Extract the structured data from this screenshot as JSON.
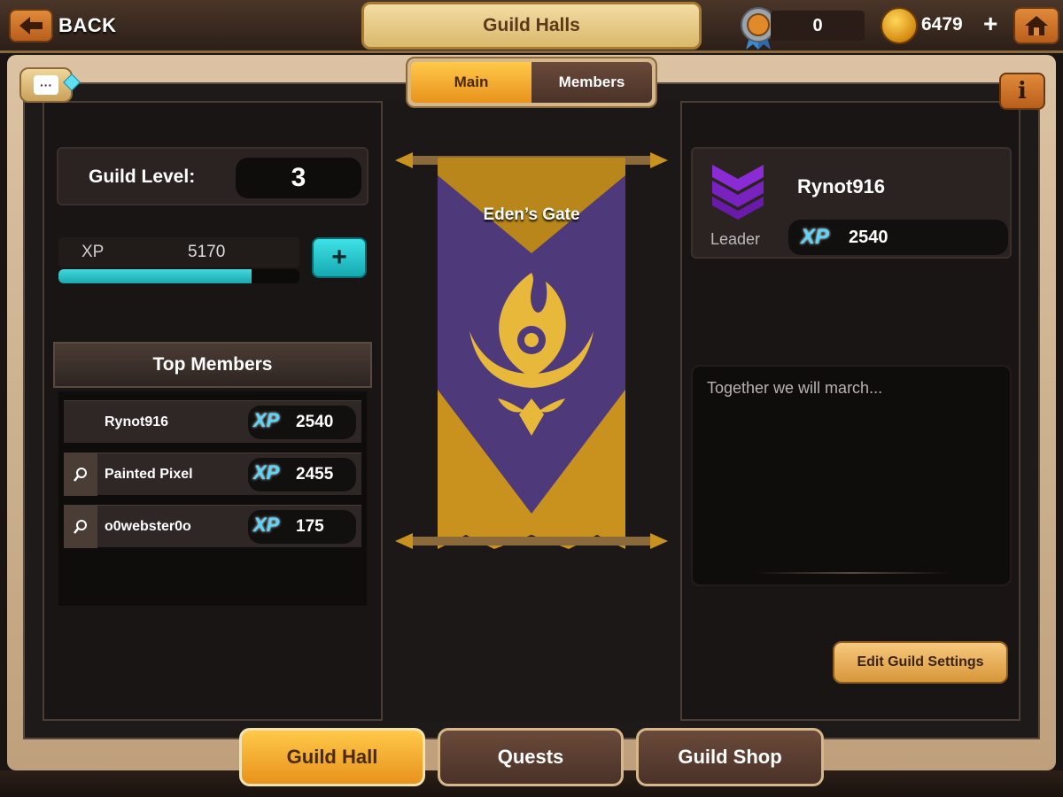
{
  "header": {
    "back_label": "BACK",
    "title": "Guild Halls",
    "badge_count": "0",
    "coins": "6479",
    "coin_plus": "+"
  },
  "tabs": [
    {
      "label": "Main",
      "active": true
    },
    {
      "label": "Members",
      "active": false
    }
  ],
  "guild": {
    "level_label": "Guild Level:",
    "level": "3",
    "xp_label": "XP",
    "xp_value": "5170",
    "xp_progress": 0.8,
    "xp_add": "+"
  },
  "top_members": {
    "title": "Top Members",
    "xp_badge": "XP",
    "rows": [
      {
        "name": "Rynot916",
        "xp": "2540",
        "has_search": false
      },
      {
        "name": "Painted Pixel",
        "xp": "2455",
        "has_search": true
      },
      {
        "name": "o0webster0o",
        "xp": "175",
        "has_search": true
      }
    ]
  },
  "banner": {
    "name": "Eden’s Gate",
    "colors": {
      "gold": "#c9921e",
      "purple": "#4e3a7a",
      "emblem": "#e8b83a"
    }
  },
  "leader": {
    "name": "Rynot916",
    "role": "Leader",
    "xp_badge": "XP",
    "xp": "2540",
    "rank_color": "#8a2bd6"
  },
  "motto": "Together we will march...",
  "edit_settings_label": "Edit Guild Settings",
  "bottom_nav": [
    {
      "label": "Guild Hall",
      "active": true
    },
    {
      "label": "Quests",
      "active": false
    },
    {
      "label": "Guild Shop",
      "active": false
    }
  ],
  "icons": {
    "back": "arrow-left-icon",
    "badge": "medal-icon",
    "coin": "coin-icon",
    "home": "home-icon",
    "chat": "chat-icon",
    "info": "info-icon",
    "search": "magnifier-icon",
    "rank": "chevron-rank-icon"
  }
}
